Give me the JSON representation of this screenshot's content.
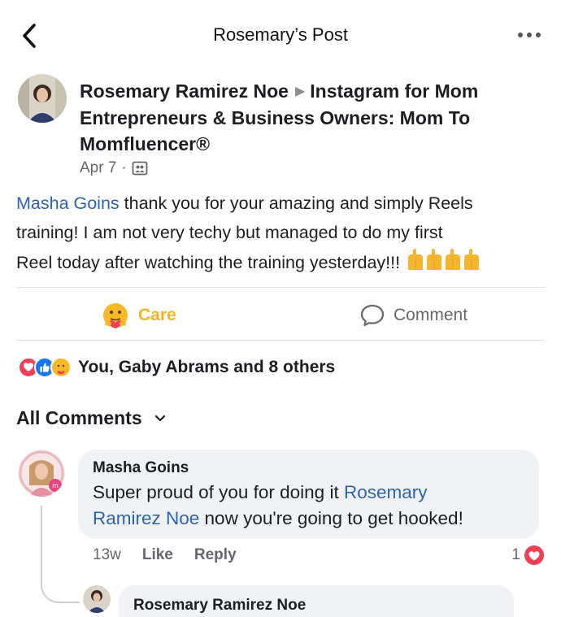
{
  "header": {
    "title": "Rosemary’s Post",
    "back_icon": "chevron-left-icon",
    "more_icon": "more-horizontal-icon"
  },
  "post": {
    "author": "Rosemary Ramirez Noe",
    "group": "Instagram for Mom Entrepreneurs & Business Owners: Mom To Momfluencer®",
    "date": "Apr 7",
    "separator": "·",
    "audience_icon": "group-audience-icon",
    "mention": "Masha Goins",
    "body_line_1": " thank you for your amazing and simply Reels",
    "body_line_2": "training! I am not very techy but managed to do my first",
    "body_line_3": "Reel today after watching the training yesterday!!! ",
    "emoji_icon": "clapping-hands-emoji"
  },
  "actions": {
    "care_label": "Care",
    "comment_label": "Comment"
  },
  "reactions": {
    "summary": "You, Gaby Abrams and 8 others",
    "icons": [
      "love-reaction-icon",
      "like-reaction-icon",
      "care-reaction-icon"
    ]
  },
  "comments_filter": {
    "label": "All Comments"
  },
  "comment": {
    "author": "Masha Goins",
    "text_before": "Super proud of you for doing it ",
    "mention_line_1": "Rosemary",
    "mention_line_2": "Ramirez Noe",
    "text_after": " now you're going to get hooked!",
    "time": "13w",
    "like_label": "Like",
    "reply_label": "Reply",
    "reaction_count": "1"
  },
  "reply": {
    "author": "Rosemary Ramirez Noe"
  },
  "colors": {
    "link": "#2c64b5",
    "care": "#f7b125",
    "love": "#f33e58",
    "like": "#1877f2",
    "bubble": "#f0f2f5",
    "secondary_text": "#65676b"
  }
}
